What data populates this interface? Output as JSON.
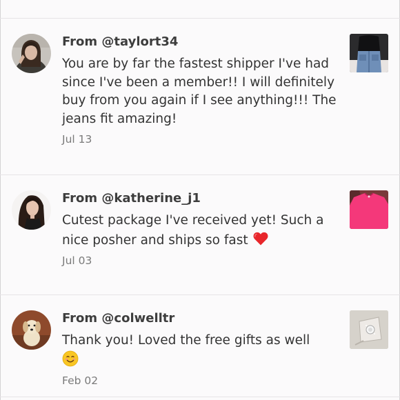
{
  "reviews": [
    {
      "from": "From @taylort34",
      "message": "You are by far the fastest shipper I've had since I've been a member!! I will definitely buy from you again if I see anything!!! The jeans fit amazing!",
      "date": "Jul 13",
      "avatar_icon": "user-avatar-photo",
      "thumb_icon": "jeans-listing-photo"
    },
    {
      "from": "From @katherine_j1",
      "message": "Cutest package I've received yet! Such a nice posher and ships so fast",
      "emoji": "red-heart-icon",
      "date": "Jul 03",
      "avatar_icon": "user-avatar-photo",
      "thumb_icon": "pink-top-listing-photo"
    },
    {
      "from": "From @colwelltr",
      "message": "Thank you! Loved the free gifts as well",
      "emoji": "smiling-face-icon",
      "date": "Feb 02",
      "avatar_icon": "dog-avatar-photo",
      "thumb_icon": "jewelry-listing-photo"
    }
  ],
  "colors": {
    "background": "#fbfafb",
    "divider": "#e6e4e6",
    "text": "#333333",
    "date": "#7a7a7a"
  }
}
